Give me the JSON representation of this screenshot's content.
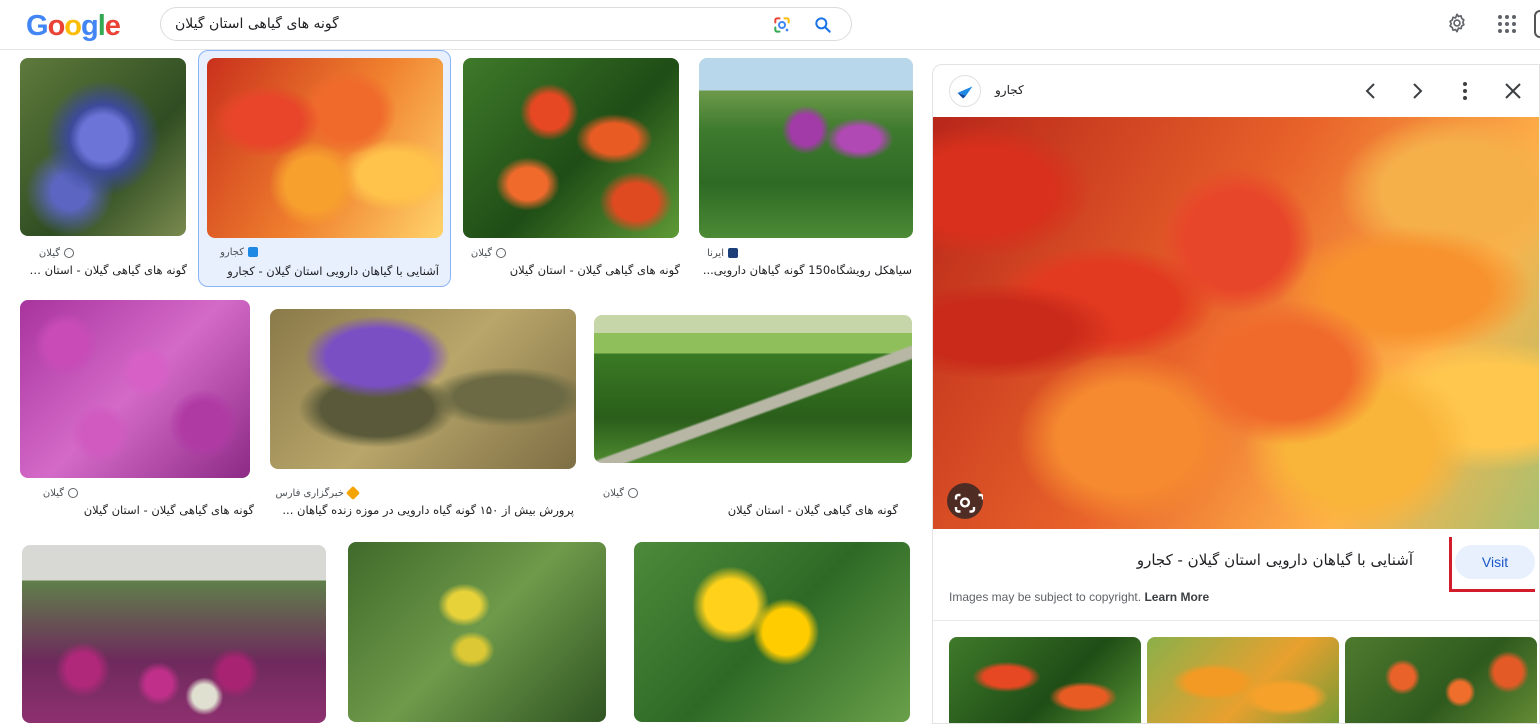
{
  "header": {
    "logo_letters": [
      "G",
      "o",
      "o",
      "g",
      "l",
      "e"
    ],
    "logo_colors": [
      "#4285f4",
      "#ea4335",
      "#fbbc05",
      "#4285f4",
      "#34a853",
      "#ea4335"
    ],
    "search_value": "گونه های گیاهی استان گیلان"
  },
  "results": [
    {
      "source": "گیلان",
      "caption": "گونه های گیاهی گیلان - استان گ..."
    },
    {
      "source": "کجارو",
      "caption": "آشنایی با گیاهان دارویی استان گیلان - کجارو"
    },
    {
      "source": "گیلان",
      "caption": "گونه های گیاهی گیلان - استان گیلان"
    },
    {
      "source": "ایرنا",
      "caption": "سیاهکل رویشگاه150 گونه گیاهان دارویی..."
    },
    {
      "source": "گیلان",
      "caption": "گونه های گیاهی گیلان - استان گیلان"
    },
    {
      "source": "خبرگزاری فارس",
      "caption": "پرورش بیش از ۱۵۰ گونه گیاه دارویی در موزه زنده گیاهان ..."
    },
    {
      "source": "گیلان",
      "caption": "گونه های گیاهی گیلان - استان گیلان"
    }
  ],
  "panel": {
    "site_name": "کجارو",
    "title": "آشنایی با گیاهان دارویی استان گیلان - کجارو",
    "visit_label": "Visit",
    "copyright_text": "Images may be subject to copyright.",
    "learn_more": "Learn More"
  },
  "colors": {
    "accent_blue": "#1a73e8",
    "selected_bg": "#e8f0fe",
    "annotation_red": "#d21c2b"
  }
}
